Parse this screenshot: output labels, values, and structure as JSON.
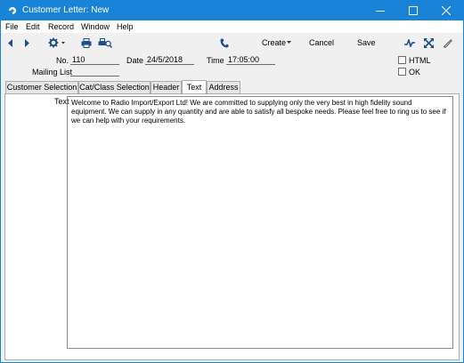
{
  "window": {
    "title": "Customer Letter: New",
    "accent": "#1883d7"
  },
  "menu": {
    "items": [
      {
        "label": "File"
      },
      {
        "label": "Edit"
      },
      {
        "label": "Record"
      },
      {
        "label": "Window"
      },
      {
        "label": "Help"
      }
    ]
  },
  "toolbar": {
    "create_label": "Create",
    "cancel_label": "Cancel",
    "save_label": "Save",
    "icons": [
      "prev-icon",
      "next-icon",
      "gear-icon",
      "print-icon",
      "print-preview-icon",
      "phone-icon",
      "activity-icon",
      "expand-icon",
      "attach-icon"
    ]
  },
  "form": {
    "no_label": "No.",
    "no_value": "110",
    "date_label": "Date",
    "date_value": "24/5/2018",
    "time_label": "Time",
    "time_value": "17:05:00",
    "mailing_list_label": "Mailing List",
    "mailing_list_value": "",
    "html_label": "HTML",
    "html_checked": false,
    "ok_label": "OK",
    "ok_checked": false
  },
  "tabs": [
    {
      "label": "Customer Selection",
      "active": false
    },
    {
      "label": "Cat/Class Selection",
      "active": false
    },
    {
      "label": "Header",
      "active": false
    },
    {
      "label": "Text",
      "active": true
    },
    {
      "label": "Address",
      "active": false
    }
  ],
  "text_tab": {
    "label": "Text",
    "content": "Welcome to Radio Import/Export Ltd! We are committed to supplying only the very best in high fidelity sound equipment. We can supply in any quantity and are able to satisfy all bespoke needs. Please feel free to ring us to see if we can help with your requirements."
  }
}
